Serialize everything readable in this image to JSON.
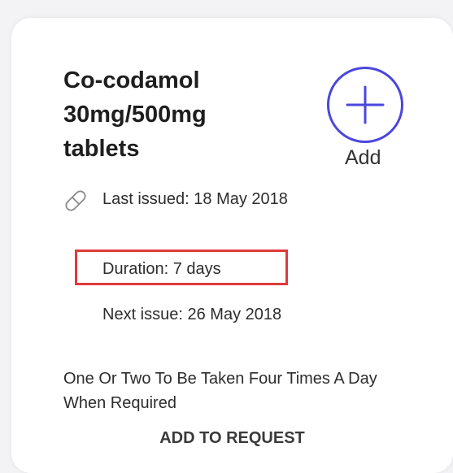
{
  "card": {
    "title": "Co-codamol 30mg/500mg tablets",
    "add_label": "Add",
    "add_icon": "plus-circle-icon",
    "pill_icon": "pill-icon",
    "last_issued": "Last issued: 18 May 2018",
    "duration": "Duration: 7 days",
    "next_issue": "Next issue: 26 May 2018",
    "instructions": "One Or Two To Be Taken Four Times A Day When Required",
    "add_to_request": "ADD TO REQUEST",
    "colors": {
      "accent": "#4b47dc",
      "highlight": "#e03a3a",
      "text": "#2d2d2d"
    }
  }
}
